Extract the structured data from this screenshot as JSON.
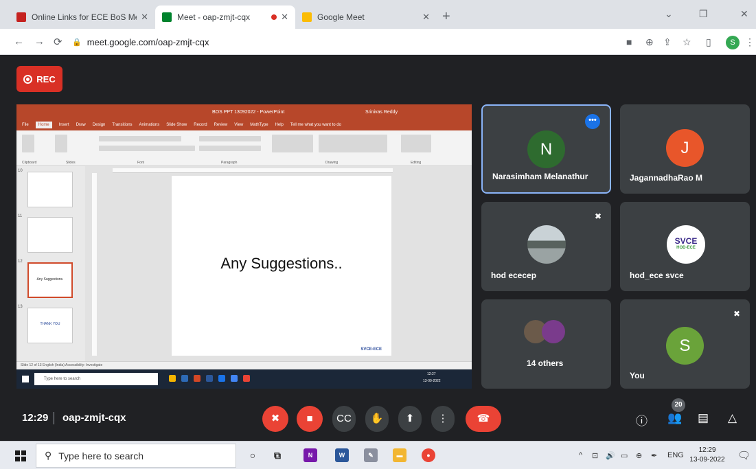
{
  "browser": {
    "tabs": [
      {
        "label": "Online Links for ECE BoS Meetin",
        "favicon_color": "#c5221f",
        "active": false
      },
      {
        "label": "Meet - oap-zmjt-cqx",
        "favicon_color": "#00832d",
        "active": true
      },
      {
        "label": "Google Meet",
        "favicon_color": "#fbbc04",
        "active": false
      }
    ],
    "url": "meet.google.com/oap-zmjt-cqx",
    "profile_initial": "S"
  },
  "meet": {
    "rec_label": "REC",
    "time": "12:29",
    "meeting_code": "oap-zmjt-cqx",
    "participant_count": "20"
  },
  "presentation": {
    "window_title": "BOS PPT 13092022 - PowerPoint",
    "user": "Srinivas Reddy",
    "menu": [
      "File",
      "Home",
      "Insert",
      "Draw",
      "Design",
      "Transitions",
      "Animations",
      "Slide Show",
      "Record",
      "Review",
      "View",
      "MathType",
      "Help",
      "Tell me what you want to do"
    ],
    "ribbon_groups": [
      "Clipboard",
      "Slides",
      "Font",
      "Paragraph",
      "Drawing",
      "Editing"
    ],
    "thumbnails": [
      {
        "number": "10",
        "text": ""
      },
      {
        "number": "11",
        "text": ""
      },
      {
        "number": "12",
        "text": "Any Suggestions."
      },
      {
        "number": "13",
        "text": "THANK YOU"
      }
    ],
    "slide_text": "Any Suggestions..",
    "slide_footer": "SVCE-ECE",
    "status_left": "Slide 12 of 13   English (India)   Accessibility: Investigate",
    "taskbar_search": "Type here to search",
    "taskbar_time": "12:27",
    "taskbar_date": "13-09-2022"
  },
  "participants": [
    {
      "name": "Narasimham Melanathur",
      "initial": "N",
      "avatar_color": "#2e6b2f",
      "active": true,
      "muted": false
    },
    {
      "name": "JagannadhaRao M",
      "initial": "J",
      "avatar_color": "#e8562a",
      "active": false,
      "muted": false
    },
    {
      "name": "hod ececep",
      "initial": "",
      "avatar_color": "#6b7a80",
      "active": false,
      "muted": true
    },
    {
      "name": "hod_ece svce",
      "initial": "",
      "avatar_color": "#ffffff",
      "logo_text": "SVCE",
      "logo_sub": "HOD-ECE",
      "active": false,
      "muted": false
    },
    {
      "name": "14 others",
      "initial": "",
      "avatar_color": "#7a5b3c",
      "active": false,
      "muted": false
    },
    {
      "name": "You",
      "initial": "S",
      "avatar_color": "#6aa33a",
      "active": false,
      "muted": true
    }
  ],
  "windows_taskbar": {
    "search_placeholder": "Type here to search",
    "time": "12:29",
    "date": "13-09-2022",
    "lang": "ENG"
  }
}
